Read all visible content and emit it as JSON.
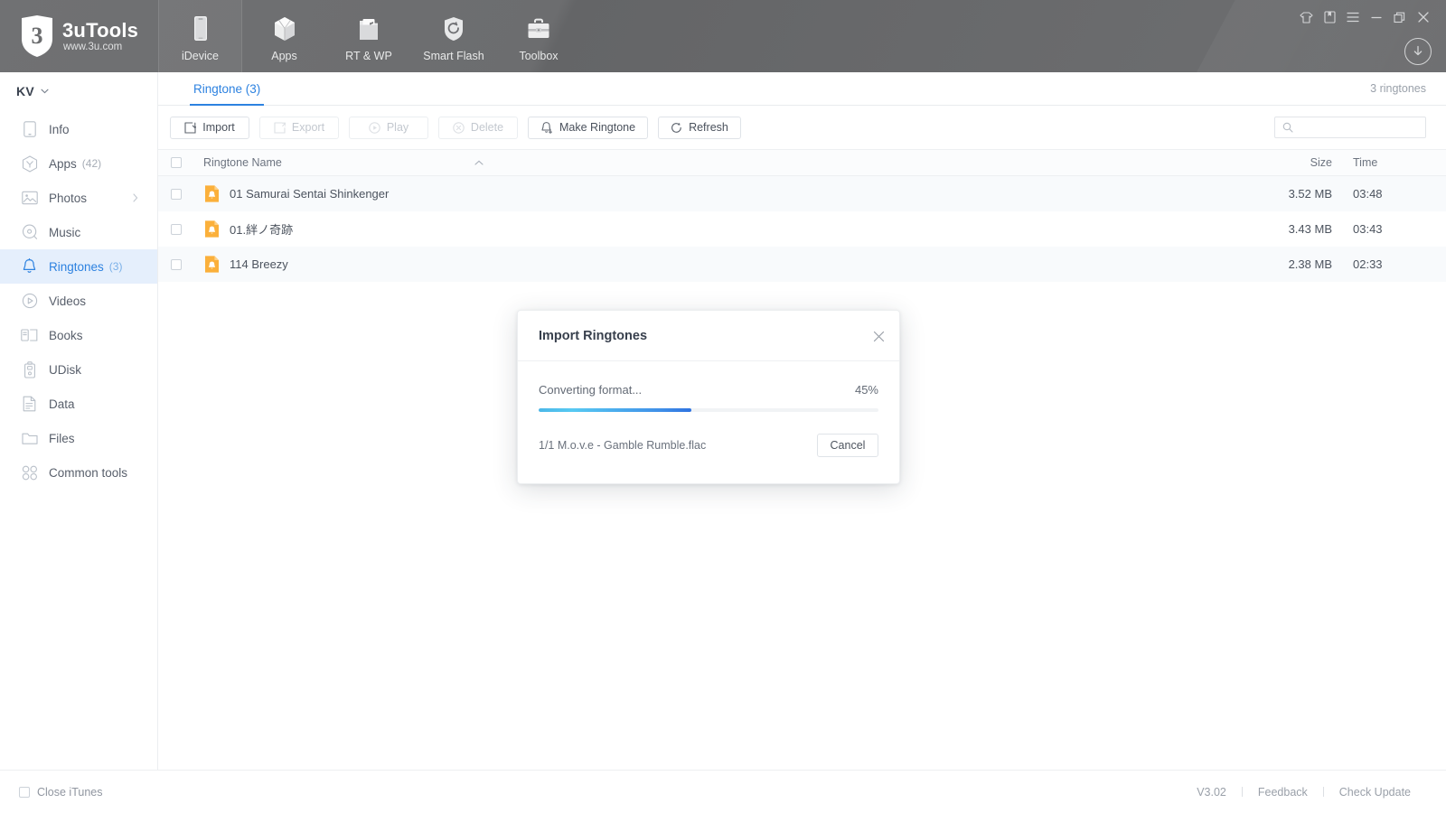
{
  "window": {
    "brand_title": "3uTools",
    "brand_sub": "www.3u.com",
    "controls": {
      "skin": "tshirt-icon",
      "notes": "book-icon",
      "menu": "hamburger-menu-icon",
      "minimize": "minimize-icon",
      "maximize": "maximize-icon",
      "close": "close-icon",
      "download": "download-icon"
    }
  },
  "nav_tabs": [
    {
      "label": "iDevice",
      "icon": "phone-icon",
      "active": true
    },
    {
      "label": "Apps",
      "icon": "cube-icon",
      "active": false
    },
    {
      "label": "RT & WP",
      "icon": "ringtone-folder-icon",
      "active": false
    },
    {
      "label": "Smart Flash",
      "icon": "flash-shield-icon",
      "active": false
    },
    {
      "label": "Toolbox",
      "icon": "toolbox-icon",
      "active": false
    }
  ],
  "sidebar": {
    "account": "KV",
    "items": [
      {
        "label": "Info",
        "icon": "device-info-icon",
        "count": "",
        "chevron": false,
        "selected": false
      },
      {
        "label": "Apps",
        "icon": "apps-icon",
        "count": "(42)",
        "chevron": false,
        "selected": false
      },
      {
        "label": "Photos",
        "icon": "photos-icon",
        "count": "",
        "chevron": true,
        "selected": false
      },
      {
        "label": "Music",
        "icon": "music-icon",
        "count": "",
        "chevron": false,
        "selected": false
      },
      {
        "label": "Ringtones",
        "icon": "bell-icon",
        "count": "(3)",
        "chevron": false,
        "selected": true
      },
      {
        "label": "Videos",
        "icon": "videos-icon",
        "count": "",
        "chevron": false,
        "selected": false
      },
      {
        "label": "Books",
        "icon": "books-icon",
        "count": "",
        "chevron": false,
        "selected": false
      },
      {
        "label": "UDisk",
        "icon": "udisk-icon",
        "count": "",
        "chevron": false,
        "selected": false
      },
      {
        "label": "Data",
        "icon": "data-icon",
        "count": "",
        "chevron": false,
        "selected": false
      },
      {
        "label": "Files",
        "icon": "files-folder-icon",
        "count": "",
        "chevron": false,
        "selected": false
      },
      {
        "label": "Common tools",
        "icon": "common-tools-icon",
        "count": "",
        "chevron": false,
        "selected": false
      }
    ]
  },
  "content": {
    "tab_label": "Ringtone (3)",
    "count_label": "3 ringtones",
    "toolbar": [
      {
        "label": "Import",
        "icon": "import-icon",
        "disabled": false
      },
      {
        "label": "Export",
        "icon": "export-icon",
        "disabled": true
      },
      {
        "label": "Play",
        "icon": "play-icon",
        "disabled": true
      },
      {
        "label": "Delete",
        "icon": "delete-icon",
        "disabled": true
      },
      {
        "label": "Make Ringtone",
        "icon": "bell-plus-icon",
        "disabled": false
      },
      {
        "label": "Refresh",
        "icon": "refresh-icon",
        "disabled": false
      }
    ],
    "search_placeholder": "",
    "search_value": "",
    "columns": {
      "name": "Ringtone Name",
      "size": "Size",
      "time": "Time"
    },
    "sort": "ascending",
    "rows": [
      {
        "name": "01 Samurai Sentai Shinkenger",
        "size": "3.52 MB",
        "time": "03:48",
        "checked": false
      },
      {
        "name": "01.絆ノ奇跡",
        "size": "3.43 MB",
        "time": "03:43",
        "checked": false
      },
      {
        "name": "114 Breezy",
        "size": "2.38 MB",
        "time": "02:33",
        "checked": false
      }
    ]
  },
  "modal": {
    "title": "Import Ringtones",
    "status": "Converting format...",
    "percent_label": "45%",
    "percent_value": 45,
    "file_line": "1/1  M.o.v.e - Gamble Rumble.flac",
    "cancel_label": "Cancel"
  },
  "footer": {
    "close_itunes": "Close iTunes",
    "version": "V3.02",
    "feedback": "Feedback",
    "check_update": "Check Update"
  },
  "colors": {
    "header_bg": "#6b6c6e",
    "accent_blue": "#2d82e0",
    "selected_bg": "#e5effc",
    "ringtone_orange": "#f6a623",
    "progress_start": "#4bb7e8",
    "progress_end": "#2f73e0"
  }
}
